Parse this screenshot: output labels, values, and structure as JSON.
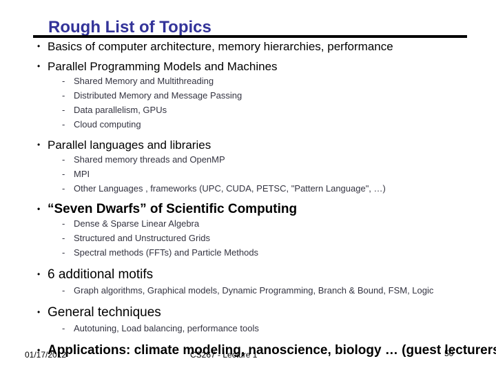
{
  "slide": {
    "title": "Rough List of Topics",
    "bullet_glyph": "•",
    "dash_glyph": "-",
    "sections": [
      {
        "text": "Basics of computer architecture, memory hierarchies, performance",
        "subs": []
      },
      {
        "text": "Parallel Programming Models and Machines",
        "subs": [
          "Shared Memory and Multithreading",
          "Distributed Memory and Message Passing",
          "Data parallelism, GPUs",
          "Cloud computing"
        ]
      },
      {
        "text": "Parallel languages and libraries",
        "subs": [
          "Shared memory threads and OpenMP",
          "MPI",
          "Other Languages , frameworks (UPC, CUDA, PETSC, \"Pattern Language\", …)"
        ]
      },
      {
        "text": "“Seven Dwarfs” of Scientific Computing",
        "subs": [
          "Dense  & Sparse Linear Algebra",
          "Structured and Unstructured Grids",
          "Spectral  methods (FFTs) and Particle Methods"
        ]
      },
      {
        "text": "6 additional motifs",
        "subs": [
          "Graph algorithms, Graphical models,  Dynamic Programming, Branch & Bound, FSM, Logic"
        ]
      },
      {
        "text": "General techniques",
        "subs": [
          "Autotuning, Load balancing,  performance  tools"
        ]
      },
      {
        "text": "Applications: climate modeling, nanoscience, biology … (guest lecturers)",
        "subs": []
      }
    ]
  },
  "footer": {
    "date": "01/17/2012",
    "course": "CS267 - Lecture 1",
    "page": "50"
  },
  "colors": {
    "title": "#333399",
    "sub_text": "#333340"
  }
}
